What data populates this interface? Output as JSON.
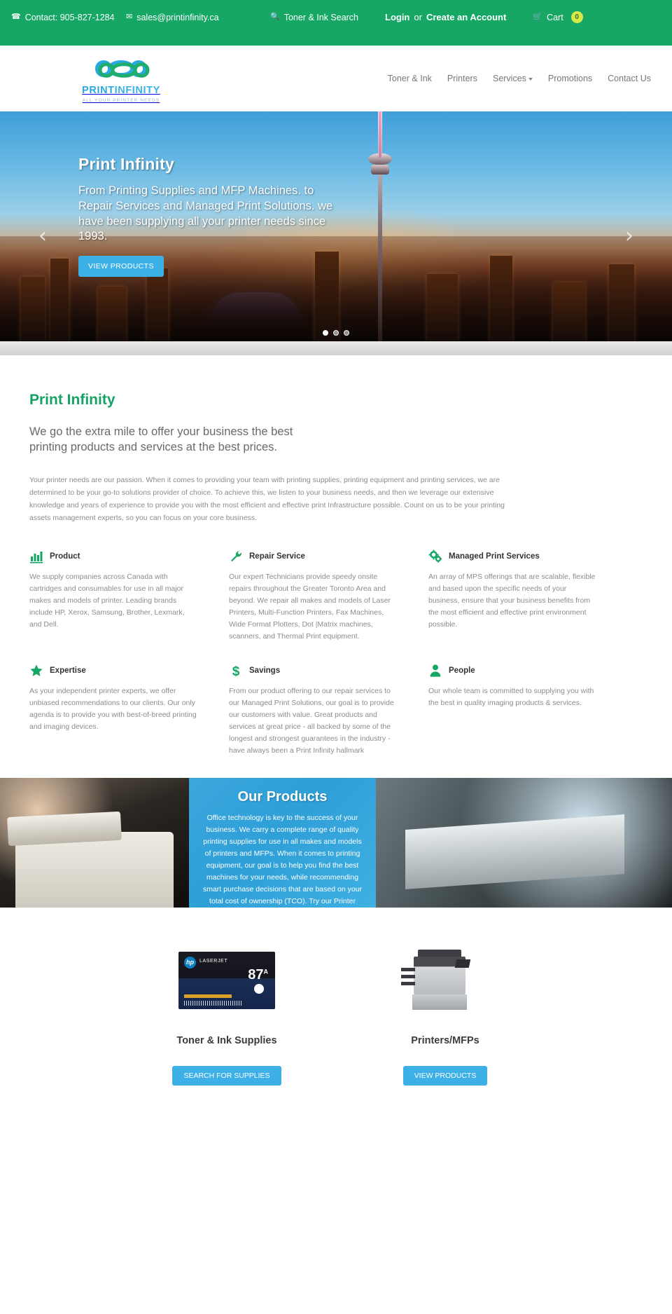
{
  "topbar": {
    "contact_label": "Contact: 905-827-1284",
    "contact_icon": "phone-icon",
    "email": "sales@printinfinity.ca",
    "email_icon": "envelope-icon",
    "search_label": "Toner & Ink Search",
    "search_icon": "search-icon",
    "login_label": "Login",
    "or_label": "or",
    "create_account_label": "Create an Account",
    "cart_label": "Cart",
    "cart_icon": "cart-icon",
    "cart_count": "0",
    "bg_color": "#16a765",
    "badge_color": "#d8e94a"
  },
  "header": {
    "logo_name_a": "PRINT",
    "logo_name_b": "INFINITY",
    "logo_tagline": "ALL YOUR PRINTER NEEDS",
    "logo_icon": "infinity-logo-icon",
    "nav": [
      {
        "label": "Toner & Ink",
        "has_caret": false
      },
      {
        "label": "Printers",
        "has_caret": false
      },
      {
        "label": "Services",
        "has_caret": true
      },
      {
        "label": "Promotions",
        "has_caret": false
      },
      {
        "label": "Contact Us",
        "has_caret": false
      }
    ]
  },
  "hero": {
    "title": "Print Infinity",
    "subtitle": "From Printing Supplies and MFP Machines. to Repair Services and Managed Print Solutions. we have been supplying all your printer needs since 1993.",
    "button_label": "VIEW PRODUCTS",
    "prev_icon": "chevron-left-icon",
    "next_icon": "chevron-right-icon",
    "slide_count": 3,
    "active_slide": 1,
    "button_color": "#3db0e8"
  },
  "intro": {
    "heading": "Print Infinity",
    "heading_color": "#16a265",
    "lead": "We go the extra mile to offer your business the best printing products and services at the best prices.",
    "body": "Your printer needs are our passion. When it comes to providing your team with printing supplies, printing equipment and printing services, we are determined to be your go-to solutions provider of choice. To achieve this, we listen to your business needs, and then we leverage our extensive knowledge and years of experience to provide you with the most efficient and effective print Infrastructure possible. Count on us to be your printing assets management experts, so you can focus on your core business."
  },
  "features": [
    {
      "icon": "bar-chart-icon",
      "title": "Product",
      "body": "We supply companies across Canada with cartridges and consumables for use in all major makes and models of printer. Leading brands include HP, Xerox, Samsung, Brother, Lexmark, and Dell."
    },
    {
      "icon": "wrench-icon",
      "title": "Repair Service",
      "body": "Our expert Technicians provide speedy onsite repairs throughout the Greater Toronto Area and beyond. We repair all makes and models of Laser Printers, Multi-Function Printers, Fax Machines, Wide Format Plotters, Dot |Matrix machines, scanners, and Thermal Print equipment."
    },
    {
      "icon": "gears-icon",
      "title": "Managed Print Services",
      "body": "An array of MPS offerings that are scalable, flexible and based upon the specific needs of your business, ensure that your business benefits from the most efficient and effective print environment possible."
    },
    {
      "icon": "star-icon",
      "title": "Expertise",
      "body": "As your independent printer experts, we offer unbiased recommendations to our clients. Our only agenda is to provide you with best-of-breed printing and imaging devices."
    },
    {
      "icon": "dollar-icon",
      "title": "Savings",
      "body": "From our product offering to our repair services to our Managed Print Solutions, our goal is to provide our customers with value. Great products and services at great price - all backed by some of the longest and strongest guarantees in the industry - have always been a Print Infinity hallmark"
    },
    {
      "icon": "person-icon",
      "title": "People",
      "body": "Our whole team is committed to supplying you with the best in quality imaging products & services."
    }
  ],
  "products_band": {
    "left_image": "hands-on-copier-photo",
    "right_image": "mfp-scanner-photo",
    "heading": "Our Products",
    "body": "Office technology is key to the success of your business. We carry a complete range of quality printing supplies for use in all makes and models of printers and MFPs. When it comes to printing equipment, our goal is to help you find the best machines for your needs, while recommending smart purchase decisions that are based on your total cost of ownership (TCO). Try our Printer Match Tool to find the",
    "bg_color": "#3aa7dd"
  },
  "cards": [
    {
      "image": "hp-laserjet-toner-cartridge-87a",
      "brand": "hp",
      "product_line": "LASERJET",
      "model_number": "87",
      "model_suffix": "A",
      "title": "Toner & Ink Supplies",
      "button_label": "SEARCH FOR SUPPLIES"
    },
    {
      "image": "multifunction-printer",
      "title": "Printers/MFPs",
      "button_label": "VIEW PRODUCTS"
    }
  ]
}
